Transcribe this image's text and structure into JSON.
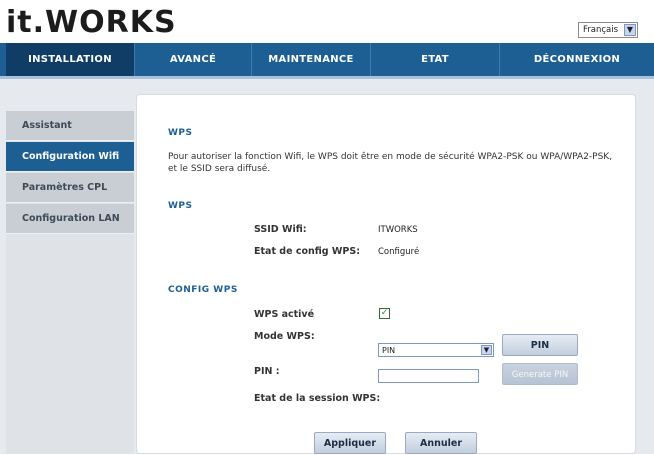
{
  "header": {
    "logo_text": "it.WORKS",
    "language": "Français"
  },
  "nav": {
    "items": [
      {
        "label": "INSTALLATION"
      },
      {
        "label": "AVANCÉ"
      },
      {
        "label": "MAINTENANCE"
      },
      {
        "label": "ETAT"
      },
      {
        "label": "DÉCONNEXION"
      }
    ]
  },
  "sidebar": {
    "items": [
      {
        "label": "Assistant"
      },
      {
        "label": "Configuration Wifi"
      },
      {
        "label": "Paramètres CPL"
      },
      {
        "label": "Configuration LAN"
      }
    ]
  },
  "main": {
    "intro_title": "WPS",
    "intro_text_line1": "Pour autoriser la fonction Wifi, le WPS doit être en mode de sécurité WPA2-PSK ou WPA/WPA2-PSK,",
    "intro_text_line2": "et le SSID sera diffusé.",
    "wps_title": "WPS",
    "ssid_label": "SSID Wifi:",
    "ssid_value": "ITWORKS",
    "config_state_label": "Etat de config WPS:",
    "config_state_value": "Configuré",
    "config_wps_title": "CONFIG WPS",
    "wps_active_label": "WPS activé",
    "mode_label": "Mode WPS:",
    "mode_value": "PIN",
    "pin_button": "PIN",
    "pin_label": "PIN :",
    "pin_value": "",
    "generate_pin_button": "Generate PIN",
    "session_label": "Etat de la session WPS:",
    "apply_button": "Appliquer",
    "cancel_button": "Annuler"
  }
}
